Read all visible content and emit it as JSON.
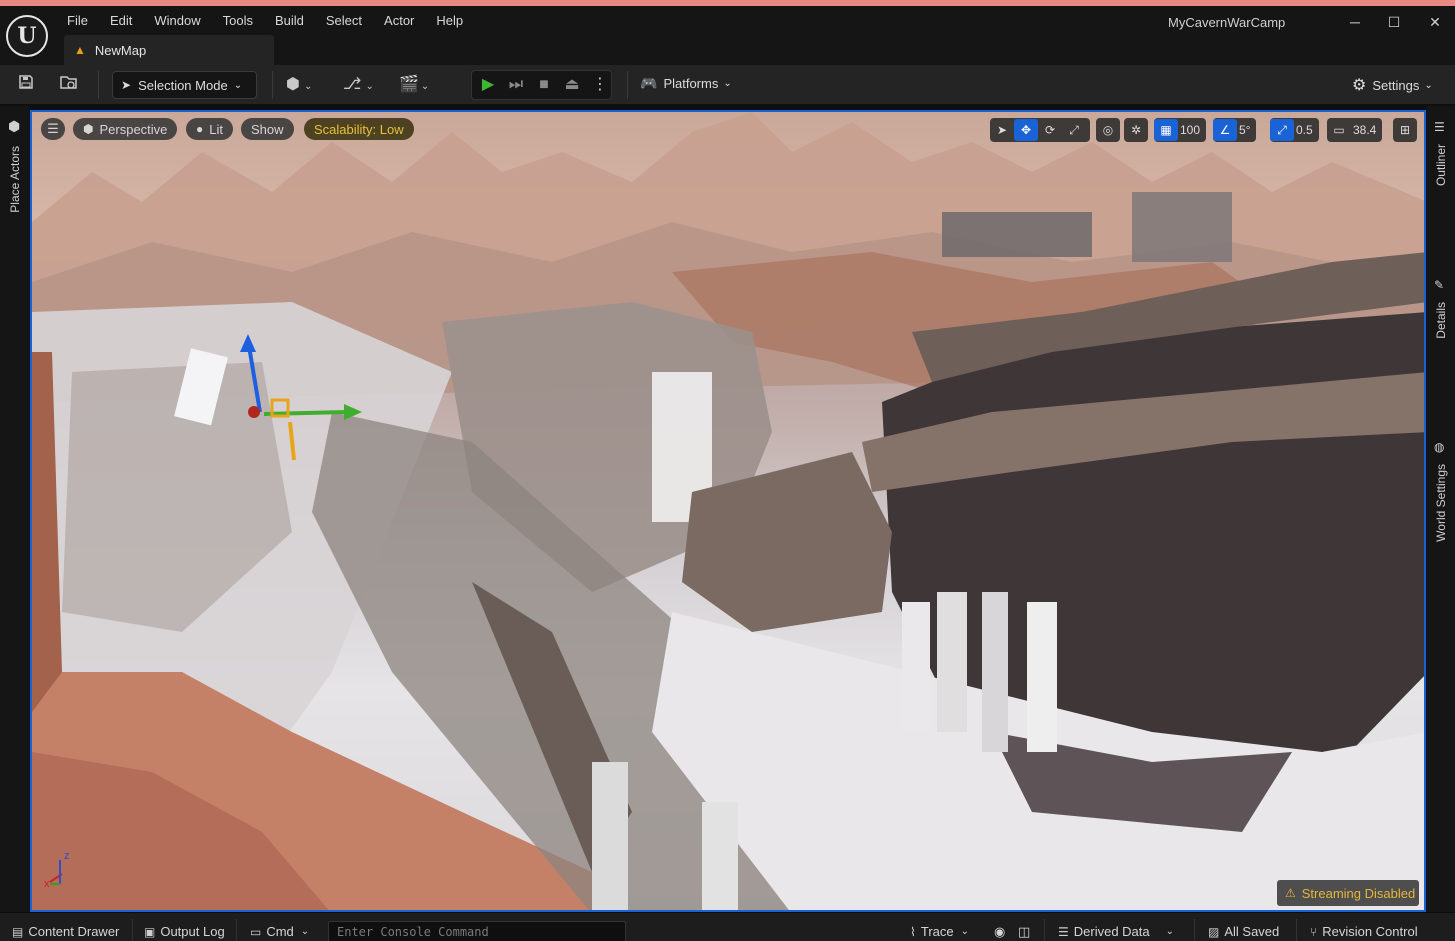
{
  "app": {
    "project_name": "MyCavernWarCamp",
    "logo": "unreal-engine-logo",
    "menu": [
      "File",
      "Edit",
      "Window",
      "Tools",
      "Build",
      "Select",
      "Actor",
      "Help"
    ],
    "window_controls": {
      "minimize": "─",
      "maximize": "☐",
      "close": "✕"
    },
    "tab": {
      "label": "NewMap",
      "icon": "level-icon"
    }
  },
  "toolbar": {
    "selection_mode": "Selection Mode",
    "platforms": "Platforms",
    "settings": "Settings",
    "icons": [
      "save-icon",
      "content-browser-icon",
      "add-actor-icon",
      "blueprint-icon",
      "cinematics-icon",
      "play-icon",
      "skip-icon",
      "stop-icon",
      "eject-icon",
      "more-options-icon"
    ]
  },
  "left_panel": {
    "place_actors": "Place Actors"
  },
  "right_panel": {
    "outliner": "Outliner",
    "details": "Details",
    "world_settings": "World Settings"
  },
  "viewport": {
    "perspective": "Perspective",
    "lit": "Lit",
    "show": "Show",
    "scalability": "Scalability: Low",
    "grid_snap": "100",
    "rotation_snap": "5°",
    "scale_snap": "0.5",
    "camera_speed": "38.4",
    "streaming": "Streaming Disabled",
    "axis_z": "z",
    "axis_x": "x"
  },
  "statusbar": {
    "content_drawer": "Content Drawer",
    "output_log": "Output Log",
    "cmd": "Cmd",
    "console_placeholder": "Enter Console Command",
    "trace": "Trace",
    "derived_data": "Derived Data",
    "all_saved": "All Saved",
    "revision_control": "Revision Control"
  },
  "colors": {
    "accent": "#1a63d6",
    "play_green": "#3fb536",
    "warning_yellow": "#e7b53a",
    "scalability_text": "#e7c13a"
  }
}
